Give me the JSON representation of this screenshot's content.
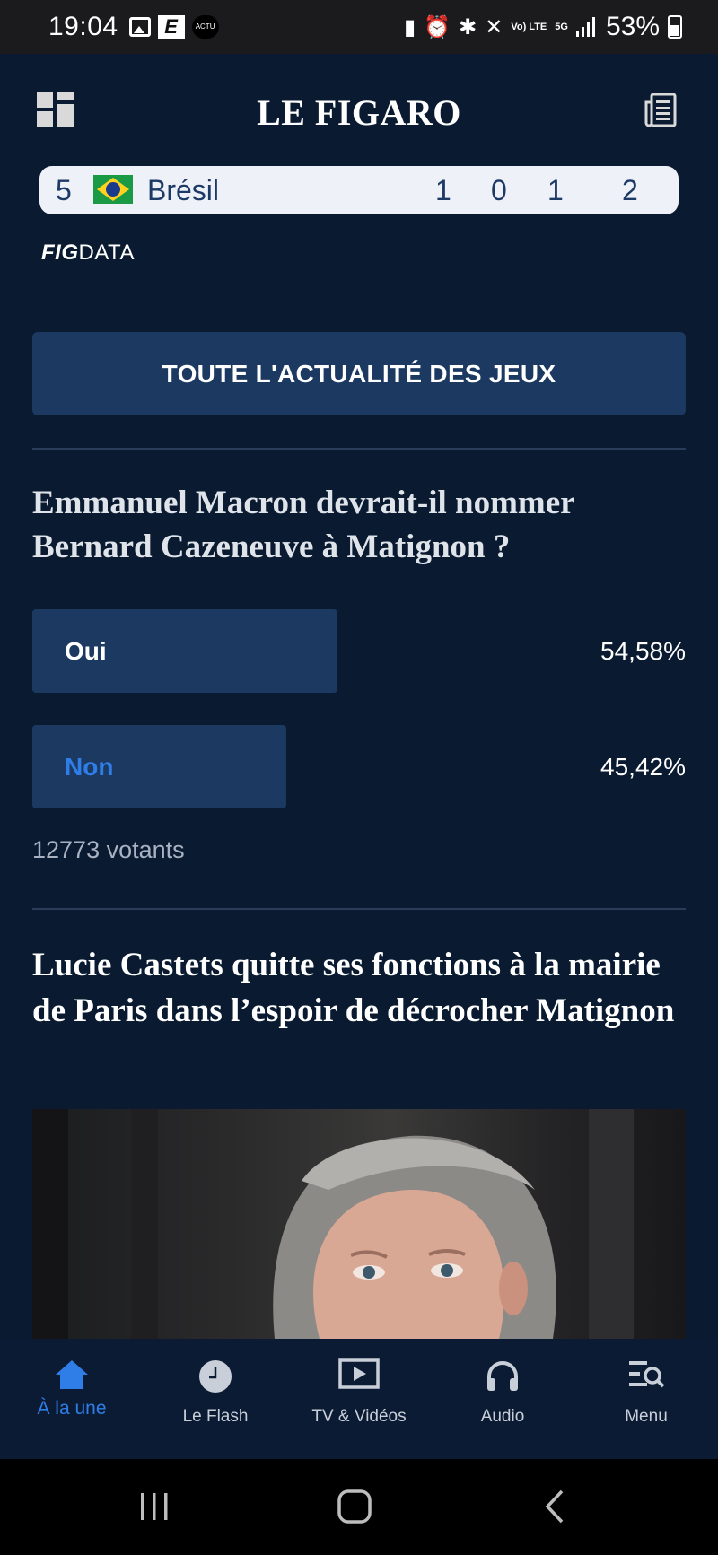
{
  "status_bar": {
    "time": "19:04",
    "battery": "53%",
    "network": "5G",
    "volte": "Vo) LTE"
  },
  "header": {
    "logo": "LE FIGARO",
    "menu_icon": "grid-icon",
    "newspaper_icon": "newspaper-icon"
  },
  "medal_table": {
    "rank": "5",
    "country": "Brésil",
    "gold": "1",
    "silver": "0",
    "bronze": "1",
    "total": "2"
  },
  "figdata": {
    "fig": "FIG",
    "data": "DATA"
  },
  "actu_button": "TOUTE L'ACTUALITÉ DES JEUX",
  "poll": {
    "question": "Emmanuel Macron devrait-il nommer Bernard Cazeneuve à Matignon ?",
    "options": [
      {
        "label": "Oui",
        "percent": "54,58%",
        "share": 0.4672,
        "color": "#ffffff"
      },
      {
        "label": "Non",
        "percent": "45,42%",
        "share": 0.3887,
        "color": "#2f7de6"
      }
    ],
    "voters": "12773 votants"
  },
  "article": {
    "title": "Lucie Castets quitte ses fonctions à la mairie de Paris dans l’espoir de décrocher Matignon"
  },
  "bottom_nav": [
    {
      "label": "À la une",
      "icon": "home-icon",
      "active": true
    },
    {
      "label": "Le Flash",
      "icon": "clock-icon",
      "active": false
    },
    {
      "label": "TV & Vidéos",
      "icon": "play-icon",
      "active": false
    },
    {
      "label": "Audio",
      "icon": "headphones-icon",
      "active": false
    },
    {
      "label": "Menu",
      "icon": "menu-search-icon",
      "active": false
    }
  ],
  "colors": {
    "background": "#0a1a30",
    "button": "#1b3961",
    "accent": "#2f7de6"
  }
}
